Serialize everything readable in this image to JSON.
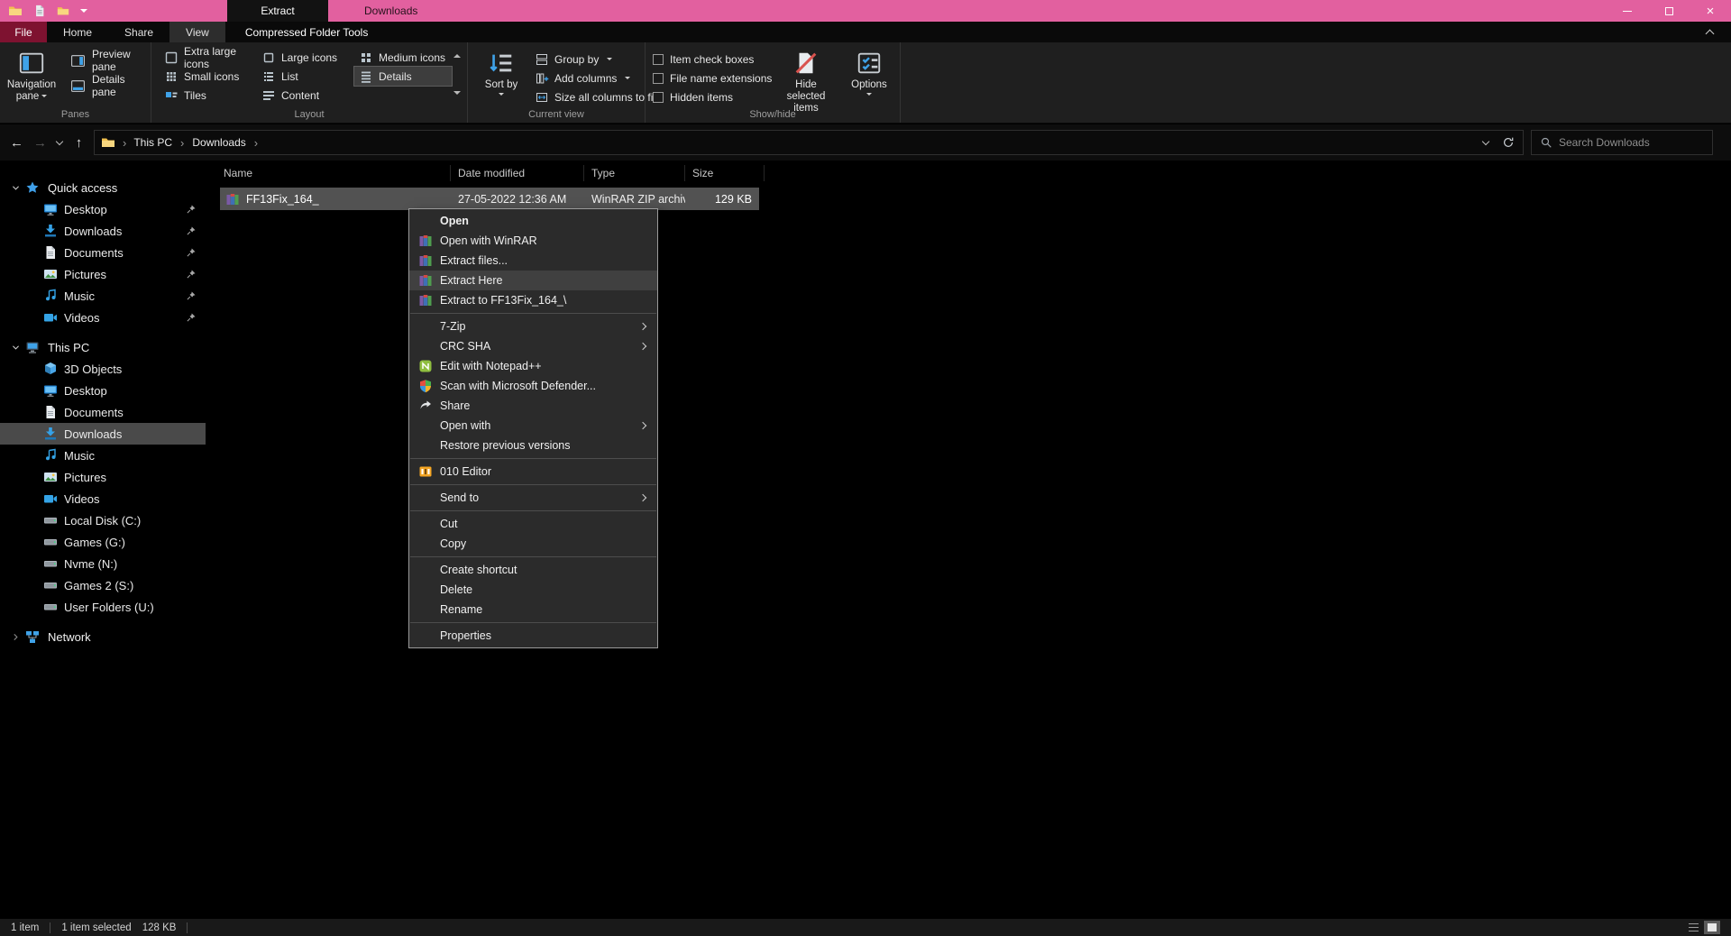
{
  "colors": {
    "accent": "#e2609f",
    "file_tab": "#7e1230",
    "selection": "#525252",
    "menu_hover": "#404040"
  },
  "titlebar": {
    "badge": "Extract",
    "title": "Downloads"
  },
  "ribbon": {
    "file": "File",
    "tabs": [
      {
        "label": "Home"
      },
      {
        "label": "Share"
      },
      {
        "label": "View",
        "cls": "active"
      },
      {
        "label": "Compressed Folder Tools",
        "cls": "contextual"
      }
    ],
    "panes": {
      "label": "Panes",
      "nav": "Navigation pane",
      "preview": "Preview pane",
      "details": "Details pane"
    },
    "layout": {
      "label": "Layout",
      "options": [
        {
          "label": "Extra large icons",
          "icon": "viewxl"
        },
        {
          "label": "Small icons",
          "icon": "viewsm"
        },
        {
          "label": "Tiles",
          "icon": "tiles"
        },
        {
          "label": "Large icons",
          "icon": "viewlg"
        },
        {
          "label": "List",
          "icon": "listv"
        },
        {
          "label": "Content",
          "icon": "content"
        },
        {
          "label": "Medium icons",
          "icon": "viewmd"
        },
        {
          "label": "Details",
          "icon": "detailsv",
          "cls": "selected"
        }
      ]
    },
    "current_view": {
      "label": "Current view",
      "sort_by": "Sort by",
      "items": [
        {
          "label": "Group by",
          "icon": "groupby",
          "cls": "dd"
        },
        {
          "label": "Add columns",
          "icon": "addcols",
          "cls": "dd"
        },
        {
          "label": "Size all columns to fit",
          "icon": "fitcols"
        }
      ]
    },
    "show_hide": {
      "label": "Show/hide",
      "checks": [
        {
          "label": "Item check boxes"
        },
        {
          "label": "File name extensions"
        },
        {
          "label": "Hidden items"
        }
      ],
      "hide_btn": "Hide selected items",
      "options_btn": "Options"
    }
  },
  "addressbar": {
    "breadcrumb": [
      "This PC",
      "Downloads"
    ],
    "search_placeholder": "Search Downloads"
  },
  "sidebar": {
    "quick_access": {
      "label": "Quick access",
      "items": [
        {
          "label": "Desktop",
          "icon": "desktop",
          "cls": "pinned"
        },
        {
          "label": "Downloads",
          "icon": "download",
          "cls": "pinned"
        },
        {
          "label": "Documents",
          "icon": "document",
          "cls": "pinned"
        },
        {
          "label": "Pictures",
          "icon": "pictures",
          "cls": "pinned"
        },
        {
          "label": "Music",
          "icon": "music",
          "cls": "pinned"
        },
        {
          "label": "Videos",
          "icon": "videos",
          "cls": "pinned"
        }
      ]
    },
    "this_pc": {
      "label": "This PC",
      "items": [
        {
          "label": "3D Objects",
          "icon": "cube"
        },
        {
          "label": "Desktop",
          "icon": "desktop"
        },
        {
          "label": "Documents",
          "icon": "document"
        },
        {
          "label": "Downloads",
          "icon": "download",
          "cls": "selected"
        },
        {
          "label": "Music",
          "icon": "music"
        },
        {
          "label": "Pictures",
          "icon": "pictures"
        },
        {
          "label": "Videos",
          "icon": "videos"
        },
        {
          "label": "Local Disk (C:)",
          "icon": "drive"
        },
        {
          "label": "Games (G:)",
          "icon": "drive"
        },
        {
          "label": "Nvme (N:)",
          "icon": "drive"
        },
        {
          "label": "Games 2 (S:)",
          "icon": "drive"
        },
        {
          "label": "User Folders (U:)",
          "icon": "drive"
        }
      ]
    },
    "network": {
      "label": "Network"
    }
  },
  "filelist": {
    "columns": [
      "Name",
      "Date modified",
      "Type",
      "Size"
    ],
    "rows": [
      {
        "name": "FF13Fix_164_",
        "date": "27-05-2022 12:36 AM",
        "type": "WinRAR ZIP archive",
        "size": "129 KB",
        "icon": "winrar",
        "cls": "selected"
      }
    ]
  },
  "context_menu": {
    "items": [
      {
        "label": "Open",
        "cls": "default"
      },
      {
        "label": "Open with WinRAR",
        "icon": "winrar"
      },
      {
        "label": "Extract files...",
        "icon": "winrar"
      },
      {
        "label": "Extract Here",
        "icon": "winrar",
        "cls": "hover"
      },
      {
        "label": "Extract to FF13Fix_164_\\",
        "icon": "winrar"
      },
      {
        "cls": "separator"
      },
      {
        "label": "7-Zip",
        "cls": "has-sub"
      },
      {
        "label": "CRC SHA",
        "cls": "has-sub"
      },
      {
        "label": "Edit with Notepad++",
        "icon": "npp"
      },
      {
        "label": "Scan with Microsoft Defender...",
        "icon": "defender"
      },
      {
        "label": "Share",
        "icon": "share"
      },
      {
        "label": "Open with",
        "cls": "has-sub"
      },
      {
        "label": "Restore previous versions"
      },
      {
        "cls": "separator"
      },
      {
        "label": "010 Editor",
        "icon": "editor010"
      },
      {
        "cls": "separator"
      },
      {
        "label": "Send to",
        "cls": "has-sub"
      },
      {
        "cls": "separator"
      },
      {
        "label": "Cut"
      },
      {
        "label": "Copy"
      },
      {
        "cls": "separator"
      },
      {
        "label": "Create shortcut"
      },
      {
        "label": "Delete"
      },
      {
        "label": "Rename"
      },
      {
        "cls": "separator"
      },
      {
        "label": "Properties"
      }
    ]
  },
  "statusbar": {
    "items_count": "1 item",
    "selection": "1 item selected",
    "size": "128 KB"
  }
}
